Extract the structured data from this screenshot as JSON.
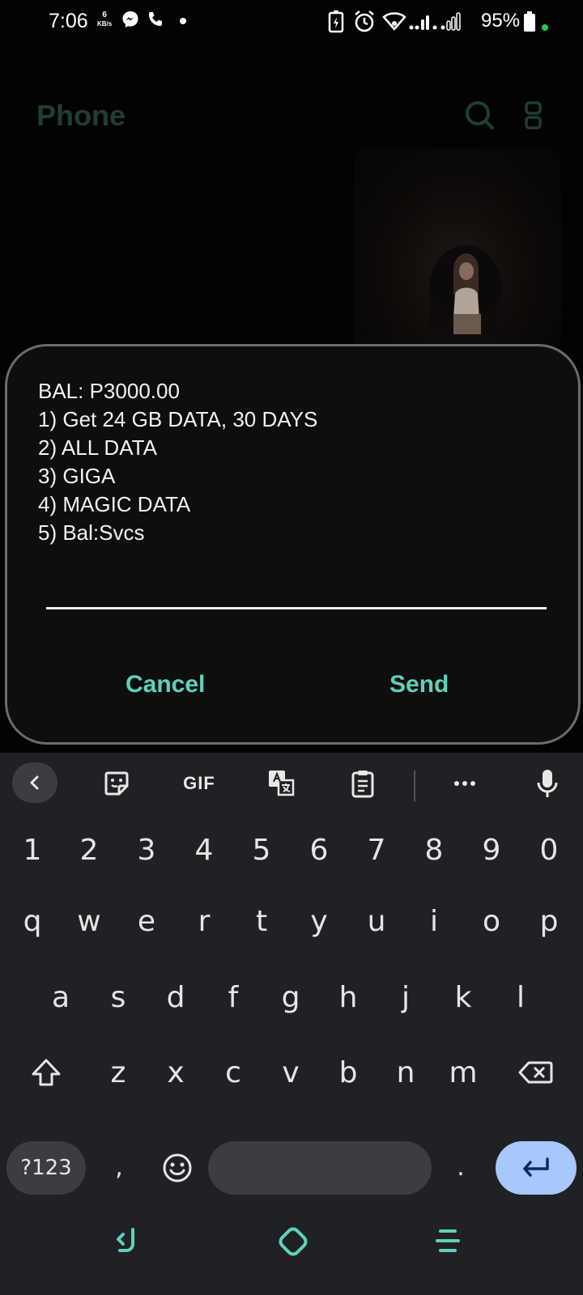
{
  "status_bar": {
    "time": "7:06",
    "speed_value": "6",
    "speed_unit": "KB/s",
    "battery": "95%"
  },
  "app": {
    "title": "Phone"
  },
  "ussd_dialog": {
    "lines": [
      "BAL: P3000.00",
      "1) Get 24 GB DATA, 30 DAYS",
      "2) ALL DATA",
      "3) GIGA",
      "4) MAGIC DATA",
      "5) Bal:Svcs"
    ],
    "input_value": "",
    "cancel_label": "Cancel",
    "send_label": "Send"
  },
  "keyboard": {
    "toolbar": {
      "gif_label": "GIF"
    },
    "number_row": [
      "1",
      "2",
      "3",
      "4",
      "5",
      "6",
      "7",
      "8",
      "9",
      "0"
    ],
    "row1": [
      "q",
      "w",
      "e",
      "r",
      "t",
      "y",
      "u",
      "i",
      "o",
      "p"
    ],
    "row2": [
      "a",
      "s",
      "d",
      "f",
      "g",
      "h",
      "j",
      "k",
      "l"
    ],
    "row3": [
      "z",
      "x",
      "c",
      "v",
      "b",
      "n",
      "m"
    ],
    "symbols_label": "?123",
    "comma": ",",
    "period": ".",
    "enter_color": "#a8c7fa"
  },
  "colors": {
    "accent": "#5ed1bd",
    "dialog_bg": "#0e0e0e",
    "keyboard_bg": "#202124"
  }
}
